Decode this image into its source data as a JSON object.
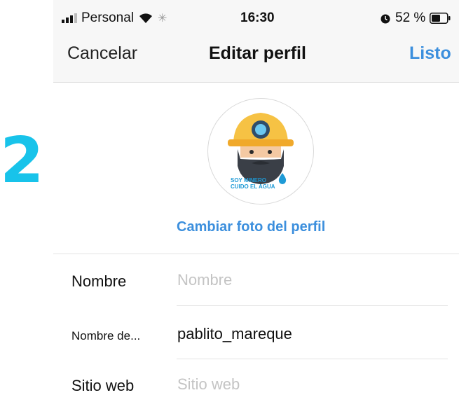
{
  "status_bar": {
    "carrier": "Personal",
    "time": "16:30",
    "battery": "52 %",
    "icons": [
      "signal-icon",
      "wifi-icon",
      "activity-icon",
      "alarm-icon",
      "battery-icon"
    ]
  },
  "nav": {
    "cancel_label": "Cancelar",
    "title": "Editar perfil",
    "done_label": "Listo"
  },
  "profile": {
    "avatar_text_line1": "SOY MINERO",
    "avatar_text_line2": "CUIDO EL AGUA",
    "change_photo_label": "Cambiar foto del perfil"
  },
  "fields": [
    {
      "label": "Nombre",
      "placeholder": "Nombre",
      "value": ""
    },
    {
      "label": "Nombre de...",
      "placeholder": "",
      "value": "pablito_mareque"
    },
    {
      "label": "Sitio web",
      "placeholder": "Sitio web",
      "value": ""
    }
  ],
  "annotation": {
    "step_number": "2",
    "color": "#18c3ea"
  },
  "colors": {
    "accent": "#3c8fdd",
    "placeholder": "#c4c4c4"
  }
}
